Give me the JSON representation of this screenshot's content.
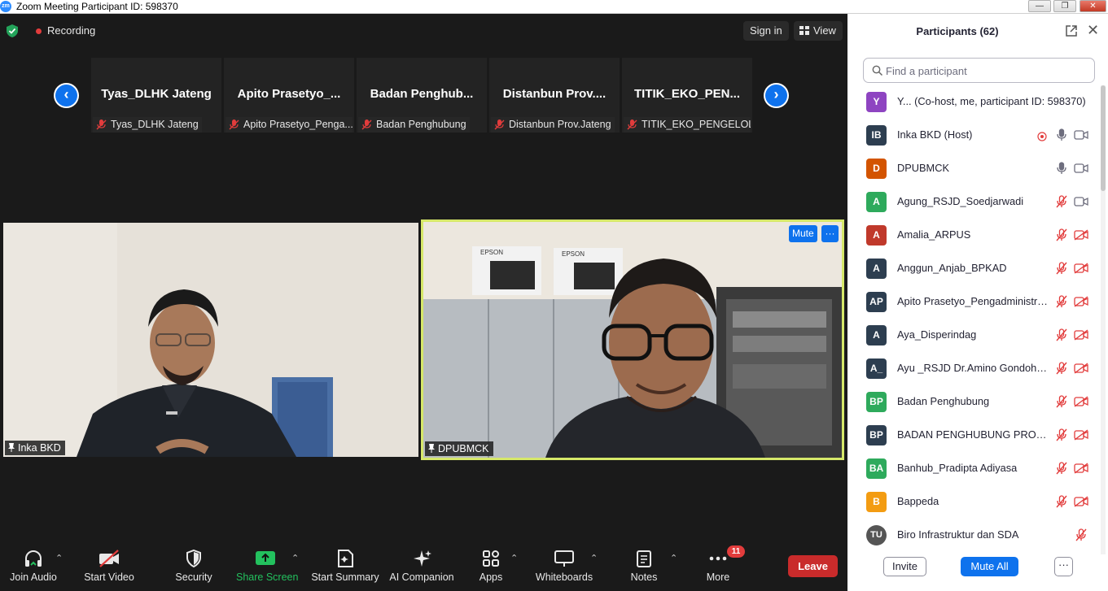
{
  "window": {
    "title": "Zoom Meeting Participant ID: 598370",
    "app_icon_text": "zm"
  },
  "top": {
    "recording": "Recording",
    "sign_in": "Sign in",
    "view": "View"
  },
  "gallery": [
    {
      "name": "Tyas_DLHK Jateng",
      "label": "Tyas_DLHK Jateng"
    },
    {
      "name": "Apito  Prasetyo_...",
      "label": "Apito Prasetyo_Penga..."
    },
    {
      "name": "Badan  Penghub...",
      "label": "Badan Penghubung"
    },
    {
      "name": "Distanbun  Prov....",
      "label": "Distanbun Prov.Jateng"
    },
    {
      "name": "TITIK_EKO_PEN...",
      "label": "TITIK_EKO_PENGELOL..."
    }
  ],
  "videos": {
    "left": {
      "label": "Inka BKD"
    },
    "right": {
      "label": "DPUBMCK",
      "mute": "Mute",
      "more": "···"
    }
  },
  "toolbar": {
    "join_audio": "Join Audio",
    "start_video": "Start Video",
    "security": "Security",
    "share_screen": "Share Screen",
    "start_summary": "Start Summary",
    "ai_companion": "AI Companion",
    "apps": "Apps",
    "whiteboards": "Whiteboards",
    "notes": "Notes",
    "more": "More",
    "more_badge": "11",
    "leave": "Leave"
  },
  "panel": {
    "title": "Participants (62)",
    "search_placeholder": "Find a participant",
    "participants": [
      {
        "initials": "Y",
        "color": "#8e44c1",
        "name": "Y...    (Co-host, me, participant ID: 598370)",
        "icons": "none"
      },
      {
        "initials": "IB",
        "color": "#2d3e50",
        "name": "Inka BKD (Host)",
        "icons": "host"
      },
      {
        "initials": "D",
        "color": "#d35400",
        "name": "DPUBMCK",
        "icons": "mic-cam"
      },
      {
        "initials": "A",
        "color": "#2eaa5c",
        "name": "Agung_RSJD_Soedjarwadi",
        "icons": "muted-cam"
      },
      {
        "initials": "A",
        "color": "#c0392b",
        "name": "Amalia_ARPUS",
        "icons": "muted-nocam"
      },
      {
        "initials": "A",
        "color": "#2d3e50",
        "name": "Anggun_Anjab_BPKAD",
        "icons": "muted-nocam"
      },
      {
        "initials": "AP",
        "color": "#2d3e50",
        "name": "Apito Prasetyo_Pengadministrasi Umum BKD",
        "icons": "muted-nocam"
      },
      {
        "initials": "A",
        "color": "#2d3e50",
        "name": "Aya_Disperindag",
        "icons": "muted-nocam"
      },
      {
        "initials": "A_",
        "color": "#2d3e50",
        "name": "Ayu _RSJD Dr.Amino Gondohutomo",
        "icons": "muted-nocam"
      },
      {
        "initials": "BP",
        "color": "#2eaa5c",
        "name": "Badan Penghubung",
        "icons": "muted-nocam"
      },
      {
        "initials": "BP",
        "color": "#2d3e50",
        "name": "BADAN PENGHUBUNG PROVINSI JATENG",
        "icons": "muted-nocam"
      },
      {
        "initials": "BA",
        "color": "#2eaa5c",
        "name": "Banhub_Pradipta Adiyasa",
        "icons": "muted-nocam"
      },
      {
        "initials": "B",
        "color": "#f39c12",
        "name": "Bappeda",
        "icons": "muted-nocam"
      },
      {
        "initials": "TU",
        "color": "#555555",
        "name": "Biro Infrastruktur dan SDA",
        "icons": "muted-only"
      }
    ],
    "invite": "Invite",
    "mute_all": "Mute All",
    "more": "···"
  }
}
